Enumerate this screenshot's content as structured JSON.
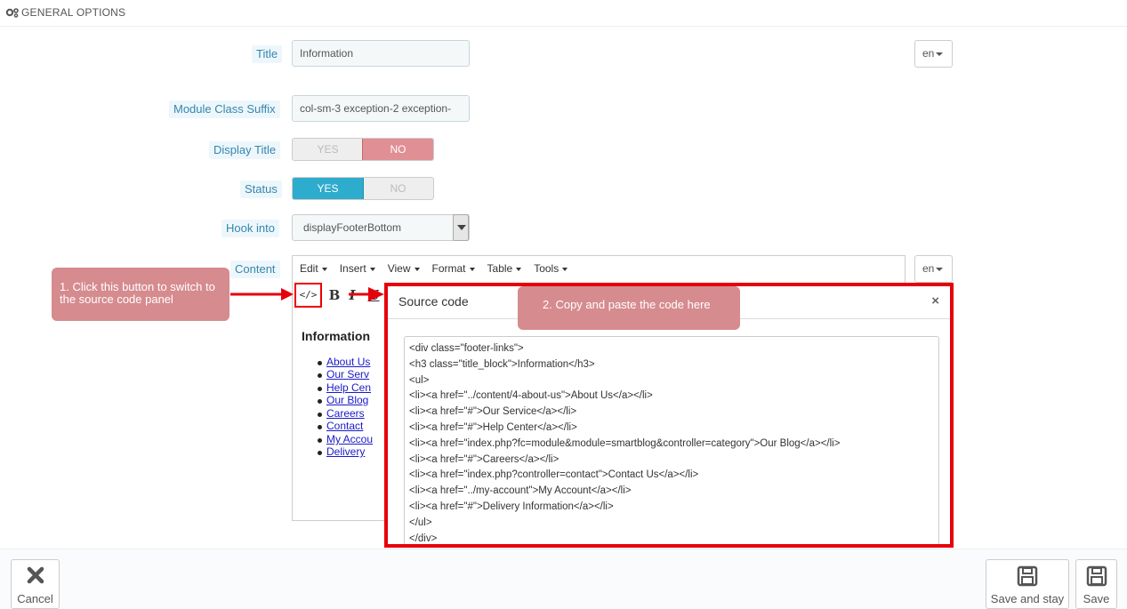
{
  "header": {
    "title": "GENERAL OPTIONS"
  },
  "form": {
    "title_label": "Title",
    "title_value": "Information",
    "lang_label": "en",
    "suffix_label": "Module Class Suffix",
    "suffix_value": "col-sm-3 exception-2  exception-",
    "display_title_label": "Display Title",
    "display_title_yes": "YES",
    "display_title_no": "NO",
    "display_title_selected": "NO",
    "status_label": "Status",
    "status_yes": "YES",
    "status_no": "NO",
    "status_selected": "YES",
    "hook_label": "Hook into",
    "hook_value": "displayFooterBottom",
    "content_label": "Content"
  },
  "editor": {
    "menus": [
      "Edit",
      "Insert",
      "View",
      "Format",
      "Table",
      "Tools"
    ],
    "source_button": "</>",
    "bold_button": "B",
    "italic_button": "I",
    "underline_button": "U",
    "heading": "Information",
    "list_items": [
      "About Us",
      "Our Serv",
      "Help Cen",
      "Our Blog",
      "Careers",
      "Contact ",
      "My Accou",
      "Delivery"
    ]
  },
  "modal": {
    "title": "Source code",
    "close": "×",
    "code_lines": [
      "<div class=\"footer-links\">",
      "<h3 class=\"title_block\">Information</h3>",
      "<ul>",
      "<li><a href=\"../content/4-about-us\">About Us</a></li>",
      "<li><a href=\"#\">Our Service</a></li>",
      "<li><a href=\"#\">Help Center</a></li>",
      "<li><a href=\"index.php?fc=module&module=smartblog&controller=category\">Our Blog</a></li>",
      "<li><a href=\"#\">Careers</a></li>",
      "<li><a href=\"index.php?controller=contact\">Contact Us</a></li>",
      "<li><a href=\"../my-account\">My Account</a></li>",
      "<li><a href=\"#\">Delivery Information</a></li>",
      "</ul>",
      "</div>"
    ]
  },
  "callouts": {
    "step1": "1. Click this button to switch to the source code panel",
    "step2": "2. Copy and paste the code here"
  },
  "footer": {
    "cancel": "Cancel",
    "save_and_stay": "Save and stay",
    "save": "Save"
  },
  "colors": {
    "label_text": "#3586ae",
    "switch_no_active": "#e08f95",
    "switch_yes_active": "#2eacce",
    "highlight_red": "#e6000b",
    "callout": "#d68b8f"
  }
}
